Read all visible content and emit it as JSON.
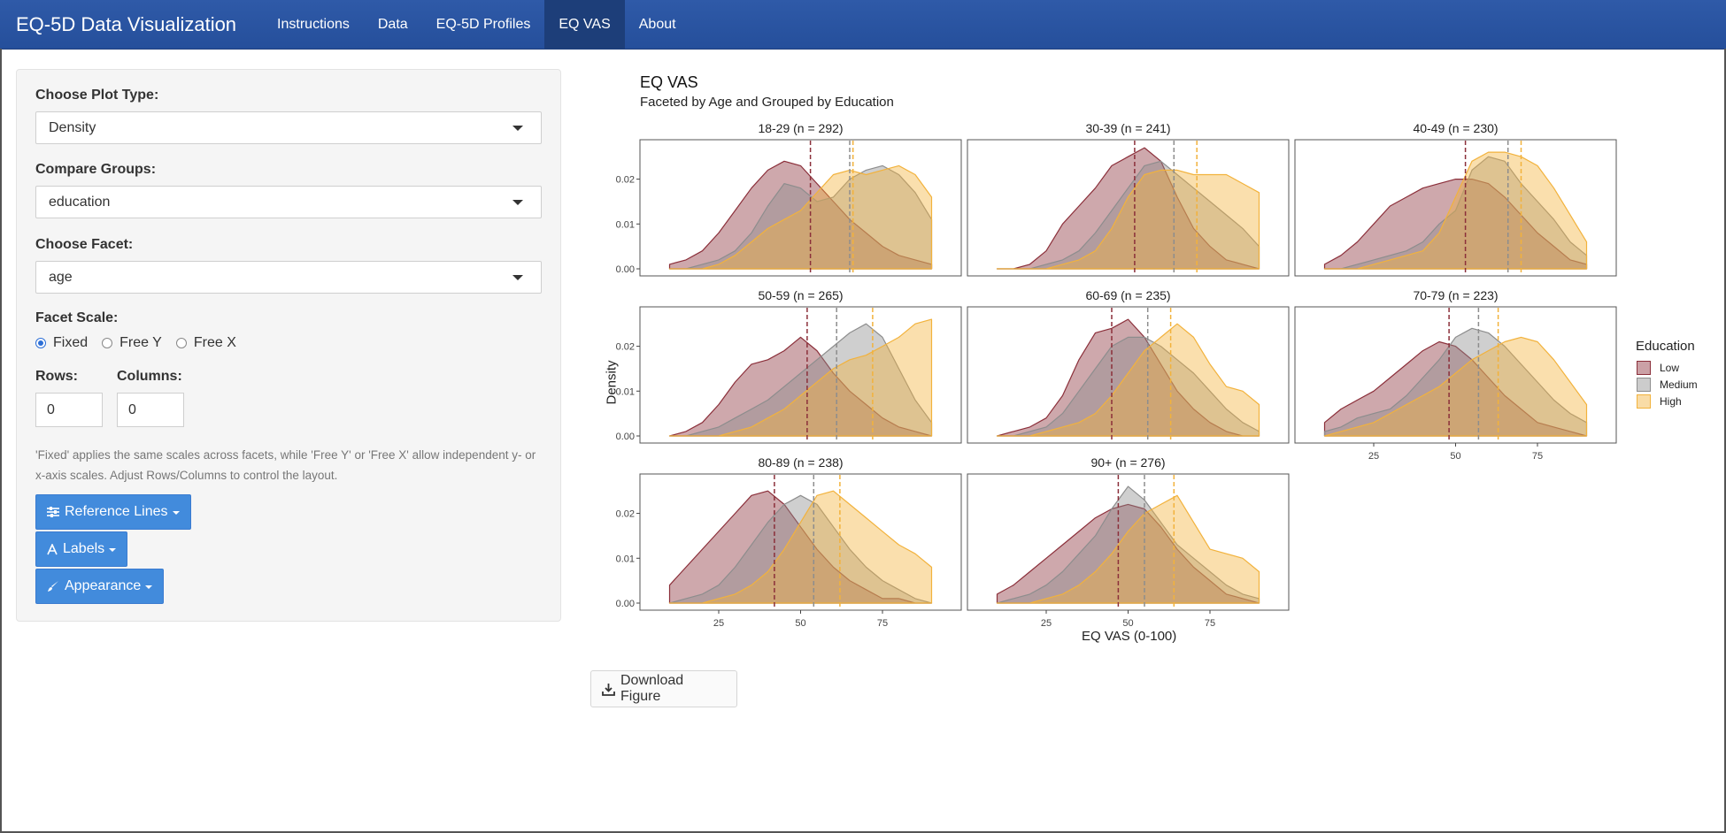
{
  "navbar": {
    "brand": "EQ-5D Data Visualization",
    "items": [
      {
        "label": "Instructions",
        "active": false
      },
      {
        "label": "Data",
        "active": false
      },
      {
        "label": "EQ-5D Profiles",
        "active": false
      },
      {
        "label": "EQ VAS",
        "active": true
      },
      {
        "label": "About",
        "active": false
      }
    ]
  },
  "sidebar": {
    "plot_type": {
      "label": "Choose Plot Type:",
      "value": "Density"
    },
    "compare_groups": {
      "label": "Compare Groups:",
      "value": "education"
    },
    "facet": {
      "label": "Choose Facet:",
      "value": "age"
    },
    "facet_scale": {
      "label": "Facet Scale:",
      "options": [
        "Fixed",
        "Free Y",
        "Free X"
      ],
      "selected": "Fixed"
    },
    "rows": {
      "label": "Rows:",
      "value": "0"
    },
    "columns": {
      "label": "Columns:",
      "value": "0"
    },
    "help_text": "'Fixed' applies the same scales across facets, while 'Free Y' or 'Free X' allow independent y- or x-axis scales. Adjust Rows/Columns to control the layout.",
    "buttons": {
      "reference_lines": "Reference Lines",
      "labels": "Labels",
      "appearance": "Appearance"
    }
  },
  "download_label": "Download Figure",
  "chart_data": {
    "type": "area",
    "title": "EQ VAS",
    "subtitle": "Faceted by Age and Grouped by Education",
    "xlabel": "EQ VAS (0-100)",
    "ylabel": "Density",
    "xlim": [
      5,
      95
    ],
    "ylim": [
      0,
      0.028
    ],
    "x_ticks": [
      25,
      50,
      75
    ],
    "y_ticks": [
      0.0,
      0.01,
      0.02
    ],
    "y_tick_labels": [
      "0.00",
      "0.01",
      "0.02"
    ],
    "grid": false,
    "legend": {
      "title": "Education",
      "position": "right",
      "entries": [
        "Low",
        "Medium",
        "High"
      ]
    },
    "colors": {
      "Low": "#8b2f3a",
      "Medium": "#8d8d8d",
      "High": "#f2b23c"
    },
    "x": [
      10,
      15,
      20,
      25,
      30,
      35,
      40,
      45,
      50,
      55,
      60,
      65,
      70,
      75,
      80,
      85,
      90
    ],
    "facets": [
      {
        "label": "18-29 (n = 292)",
        "means": {
          "Low": 53,
          "Medium": 65,
          "High": 66
        },
        "series": [
          {
            "name": "Low",
            "values": [
              0.001,
              0.002,
              0.004,
              0.008,
              0.013,
              0.018,
              0.022,
              0.024,
              0.023,
              0.019,
              0.015,
              0.011,
              0.008,
              0.005,
              0.003,
              0.002,
              0.001
            ]
          },
          {
            "name": "Medium",
            "values": [
              0,
              0,
              0.001,
              0.002,
              0.004,
              0.008,
              0.014,
              0.019,
              0.018,
              0.015,
              0.016,
              0.02,
              0.022,
              0.023,
              0.021,
              0.017,
              0.011
            ]
          },
          {
            "name": "High",
            "values": [
              0,
              0,
              0,
              0.001,
              0.003,
              0.006,
              0.009,
              0.011,
              0.013,
              0.017,
              0.021,
              0.022,
              0.021,
              0.022,
              0.023,
              0.021,
              0.016
            ]
          }
        ]
      },
      {
        "label": "30-39 (n = 241)",
        "means": {
          "Low": 52,
          "Medium": 64,
          "High": 71
        },
        "series": [
          {
            "name": "Low",
            "values": [
              0,
              0,
              0.001,
              0.004,
              0.01,
              0.014,
              0.018,
              0.023,
              0.025,
              0.027,
              0.024,
              0.016,
              0.009,
              0.005,
              0.002,
              0.001,
              0
            ]
          },
          {
            "name": "Medium",
            "values": [
              0,
              0,
              0,
              0.001,
              0.002,
              0.004,
              0.008,
              0.013,
              0.018,
              0.023,
              0.024,
              0.021,
              0.018,
              0.015,
              0.012,
              0.009,
              0.005
            ]
          },
          {
            "name": "High",
            "values": [
              0,
              0,
              0,
              0,
              0.001,
              0.002,
              0.004,
              0.009,
              0.016,
              0.021,
              0.022,
              0.022,
              0.021,
              0.021,
              0.021,
              0.019,
              0.017
            ]
          }
        ]
      },
      {
        "label": "40-49 (n = 230)",
        "means": {
          "Low": 53,
          "Medium": 66,
          "High": 70
        },
        "series": [
          {
            "name": "Low",
            "values": [
              0.001,
              0.003,
              0.006,
              0.01,
              0.014,
              0.016,
              0.018,
              0.019,
              0.02,
              0.02,
              0.019,
              0.016,
              0.012,
              0.008,
              0.005,
              0.002,
              0.001
            ]
          },
          {
            "name": "Medium",
            "values": [
              0,
              0,
              0.001,
              0.002,
              0.003,
              0.004,
              0.006,
              0.01,
              0.013,
              0.022,
              0.025,
              0.024,
              0.019,
              0.015,
              0.011,
              0.006,
              0.003
            ]
          },
          {
            "name": "High",
            "values": [
              0,
              0,
              0,
              0.001,
              0.002,
              0.003,
              0.004,
              0.008,
              0.016,
              0.024,
              0.026,
              0.026,
              0.025,
              0.023,
              0.018,
              0.012,
              0.006
            ]
          }
        ]
      },
      {
        "label": "50-59 (n = 265)",
        "means": {
          "Low": 52,
          "Medium": 61,
          "High": 72
        },
        "series": [
          {
            "name": "Low",
            "values": [
              0,
              0.001,
              0.003,
              0.007,
              0.012,
              0.016,
              0.017,
              0.019,
              0.022,
              0.019,
              0.014,
              0.01,
              0.007,
              0.004,
              0.002,
              0.001,
              0
            ]
          },
          {
            "name": "Medium",
            "values": [
              0,
              0,
              0.001,
              0.002,
              0.004,
              0.006,
              0.008,
              0.011,
              0.014,
              0.017,
              0.02,
              0.023,
              0.025,
              0.022,
              0.015,
              0.008,
              0.003
            ]
          },
          {
            "name": "High",
            "values": [
              0,
              0,
              0,
              0,
              0.001,
              0.002,
              0.004,
              0.006,
              0.009,
              0.012,
              0.015,
              0.017,
              0.018,
              0.02,
              0.022,
              0.025,
              0.026
            ]
          }
        ]
      },
      {
        "label": "60-69 (n = 235)",
        "means": {
          "Low": 45,
          "Medium": 56,
          "High": 63
        },
        "series": [
          {
            "name": "Low",
            "values": [
              0,
              0.001,
              0.002,
              0.004,
              0.009,
              0.017,
              0.023,
              0.024,
              0.026,
              0.022,
              0.016,
              0.01,
              0.006,
              0.003,
              0.001,
              0,
              0
            ]
          },
          {
            "name": "Medium",
            "values": [
              0,
              0,
              0.001,
              0.002,
              0.005,
              0.01,
              0.015,
              0.02,
              0.022,
              0.022,
              0.02,
              0.017,
              0.014,
              0.01,
              0.006,
              0.003,
              0.001
            ]
          },
          {
            "name": "High",
            "values": [
              0,
              0,
              0,
              0.001,
              0.002,
              0.003,
              0.005,
              0.009,
              0.014,
              0.019,
              0.022,
              0.025,
              0.022,
              0.016,
              0.011,
              0.01,
              0.007
            ]
          }
        ]
      },
      {
        "label": "70-79 (n = 223)",
        "means": {
          "Low": 48,
          "Medium": 57,
          "High": 63
        },
        "series": [
          {
            "name": "Low",
            "values": [
              0.003,
              0.006,
              0.008,
              0.01,
              0.013,
              0.016,
              0.019,
              0.021,
              0.02,
              0.017,
              0.013,
              0.009,
              0.006,
              0.003,
              0.002,
              0.001,
              0
            ]
          },
          {
            "name": "Medium",
            "values": [
              0.001,
              0.002,
              0.004,
              0.005,
              0.006,
              0.009,
              0.013,
              0.017,
              0.022,
              0.024,
              0.023,
              0.02,
              0.016,
              0.012,
              0.008,
              0.005,
              0.003
            ]
          },
          {
            "name": "High",
            "values": [
              0,
              0.001,
              0.002,
              0.003,
              0.005,
              0.007,
              0.009,
              0.011,
              0.014,
              0.017,
              0.019,
              0.021,
              0.022,
              0.021,
              0.017,
              0.012,
              0.007
            ]
          }
        ]
      },
      {
        "label": "80-89 (n = 238)",
        "means": {
          "Low": 42,
          "Medium": 54,
          "High": 62
        },
        "series": [
          {
            "name": "Low",
            "values": [
              0.004,
              0.008,
              0.012,
              0.016,
              0.02,
              0.024,
              0.025,
              0.022,
              0.017,
              0.012,
              0.008,
              0.005,
              0.003,
              0.001,
              0.001,
              0,
              0
            ]
          },
          {
            "name": "Medium",
            "values": [
              0,
              0.001,
              0.002,
              0.004,
              0.008,
              0.013,
              0.018,
              0.022,
              0.024,
              0.022,
              0.017,
              0.012,
              0.008,
              0.005,
              0.003,
              0.001,
              0
            ]
          },
          {
            "name": "High",
            "values": [
              0,
              0,
              0,
              0.001,
              0.002,
              0.004,
              0.007,
              0.012,
              0.018,
              0.024,
              0.025,
              0.022,
              0.019,
              0.016,
              0.013,
              0.011,
              0.008
            ]
          }
        ]
      },
      {
        "label": "90+ (n = 276)",
        "means": {
          "Low": 47,
          "Medium": 55,
          "High": 64
        },
        "series": [
          {
            "name": "Low",
            "values": [
              0.002,
              0.004,
              0.007,
              0.01,
              0.013,
              0.016,
              0.019,
              0.021,
              0.022,
              0.021,
              0.017,
              0.012,
              0.008,
              0.005,
              0.002,
              0.001,
              0
            ]
          },
          {
            "name": "Medium",
            "values": [
              0,
              0.001,
              0.002,
              0.004,
              0.007,
              0.011,
              0.015,
              0.021,
              0.026,
              0.023,
              0.018,
              0.013,
              0.01,
              0.007,
              0.004,
              0.002,
              0.001
            ]
          },
          {
            "name": "High",
            "values": [
              0,
              0,
              0,
              0.001,
              0.002,
              0.004,
              0.007,
              0.011,
              0.016,
              0.02,
              0.022,
              0.024,
              0.018,
              0.012,
              0.011,
              0.01,
              0.007
            ]
          }
        ]
      }
    ]
  }
}
